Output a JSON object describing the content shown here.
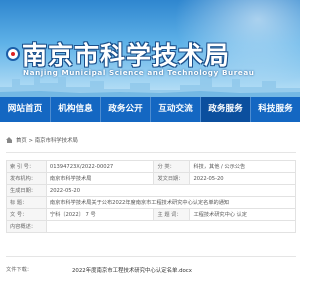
{
  "header": {
    "title": "南京市科学技术局",
    "subtitle": "Nanjing Municipal Science and Technology Bureau"
  },
  "nav": {
    "items": [
      {
        "label": "网站首页"
      },
      {
        "label": "机构信息"
      },
      {
        "label": "政务公开"
      },
      {
        "label": "互动交流"
      },
      {
        "label": "政务服务"
      },
      {
        "label": "科技服务"
      }
    ],
    "active_index": 4
  },
  "breadcrumb": {
    "text": "首页 > 南京市科学技术局"
  },
  "info": {
    "rows": [
      {
        "c1": "索 引 号：",
        "c2": "01394723X/2022-00027",
        "c3": "分    类：",
        "c4": "科技，其他 / 公示公告"
      },
      {
        "c1": "发布机构：",
        "c2": "南京市科学技术局",
        "c3": "发文日期：",
        "c4": "2022-05-20"
      },
      {
        "c1": "生成日期：",
        "c2": "2022-05-20",
        "c3": "",
        "c4": ""
      },
      {
        "c1": "标    题：",
        "c2": "南京市科学技术局关于公布2022年度南京市工程技术研究中心认定名单的通知",
        "c3": "",
        "c4": ""
      },
      {
        "c1": "文    号：",
        "c2": "宁科〔2022〕 7 号",
        "c3": "主 题 词：",
        "c4": "工程技术研究中心 认定"
      },
      {
        "c1": "内容概述：",
        "c2": "",
        "c3": "",
        "c4": ""
      }
    ]
  },
  "attachment": {
    "label": "文件下载：",
    "file": "2022年度南京市工程技术研究中心认定名单.docx"
  },
  "colors": {
    "nav_bg": "#1467c2",
    "nav_active": "#0b4f9e",
    "banner_top": "#2f86cf",
    "banner_bottom": "#bfe3f7"
  }
}
